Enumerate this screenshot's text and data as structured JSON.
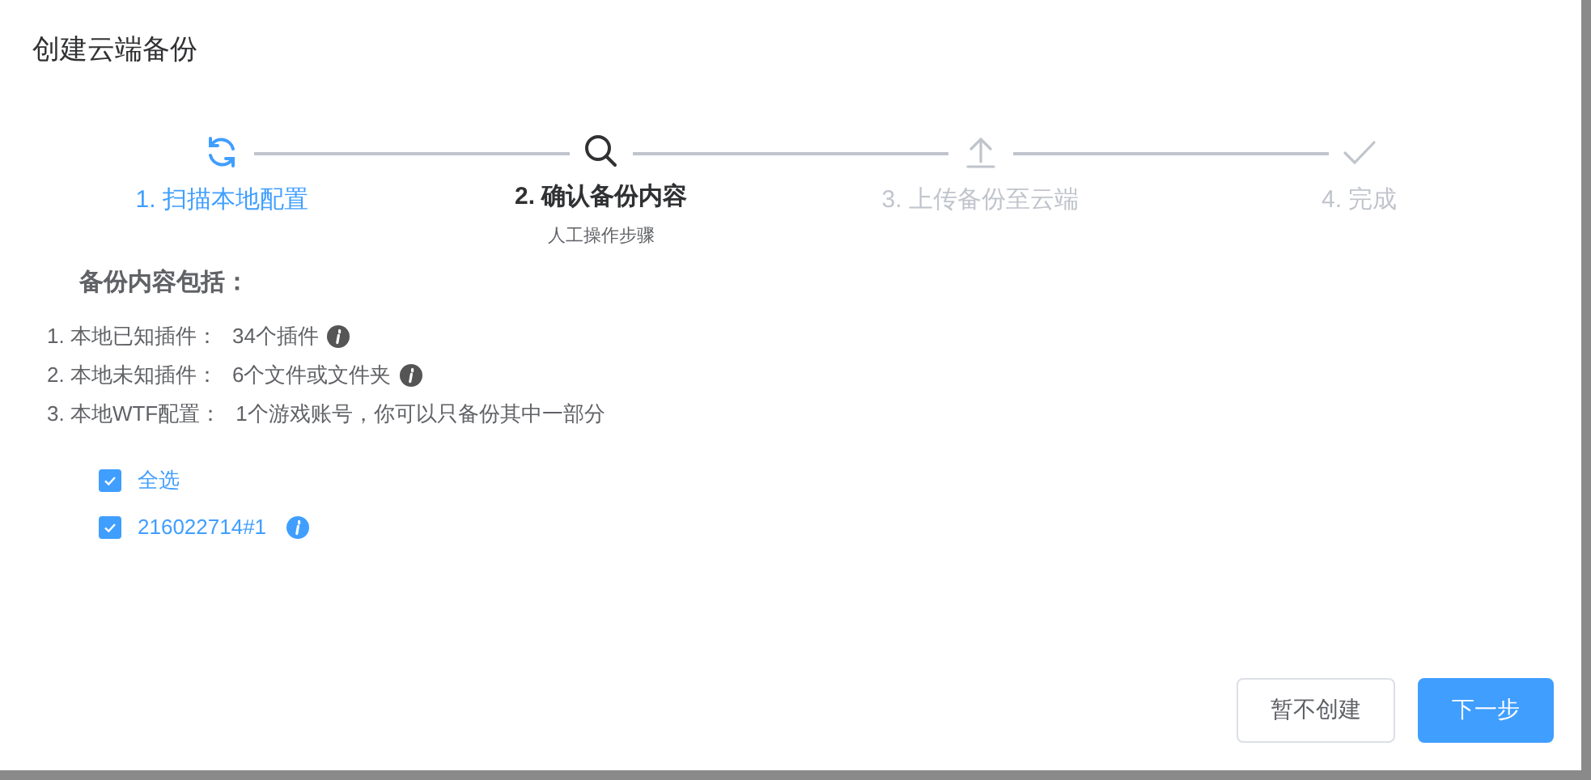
{
  "dialog": {
    "title": "创建云端备份"
  },
  "steps": [
    {
      "label": "1. 扫描本地配置",
      "kind": "done"
    },
    {
      "label": "2. 确认备份内容",
      "kind": "current",
      "description": "人工操作步骤"
    },
    {
      "label": "3. 上传备份至云端",
      "kind": "pending"
    },
    {
      "label": "4. 完成",
      "kind": "pending"
    }
  ],
  "content": {
    "heading": "备份内容包括：",
    "items": [
      {
        "label": "1. 本地已知插件：",
        "value": "34个插件",
        "info": true
      },
      {
        "label": "2. 本地未知插件：",
        "value": "6个文件或文件夹",
        "info": true
      },
      {
        "label": "3. 本地WTF配置：",
        "value": "1个游戏账号，你可以只备份其中一部分",
        "info": false
      }
    ],
    "checkboxes": [
      {
        "label": "全选",
        "checked": true,
        "info": false
      },
      {
        "label": "216022714#1",
        "checked": true,
        "info": true
      }
    ]
  },
  "buttons": [
    {
      "label": "暂不创建",
      "kind": "secondary"
    },
    {
      "label": "下一步",
      "kind": "primary"
    }
  ]
}
